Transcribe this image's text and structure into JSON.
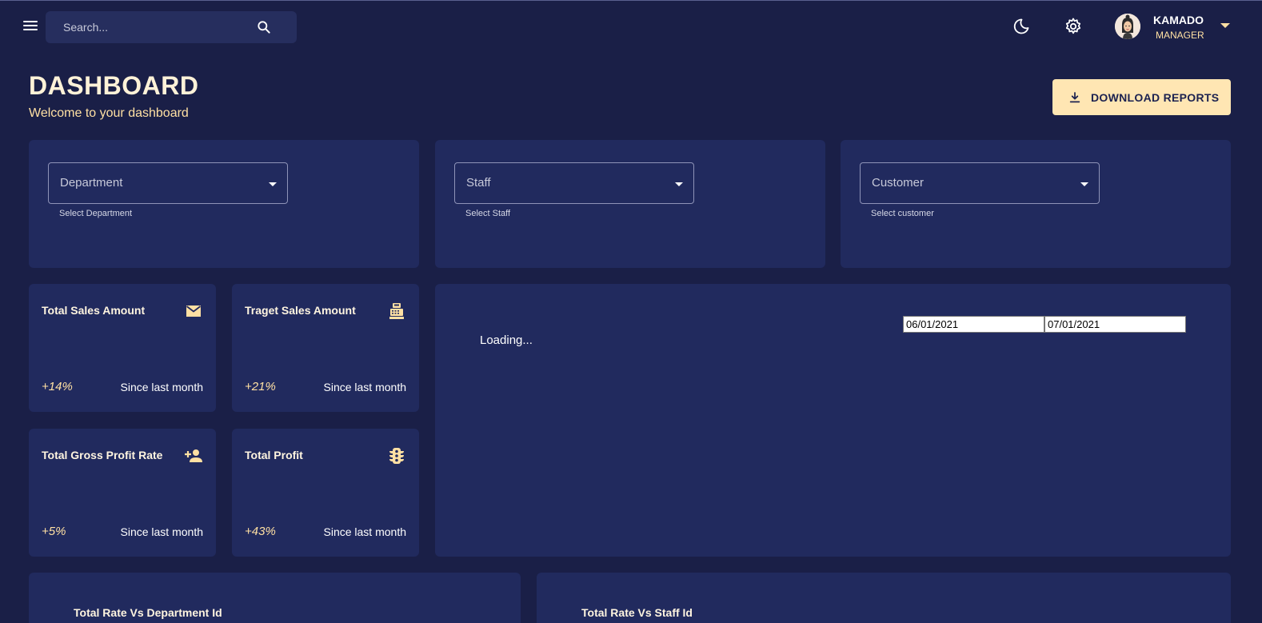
{
  "topbar": {
    "search_placeholder": "Search...",
    "user": {
      "name": "KAMADO",
      "role": "MANAGER"
    }
  },
  "header": {
    "title": "DASHBOARD",
    "subtitle": "Welcome to your dashboard",
    "download_label": "DOWNLOAD REPORTS"
  },
  "filters": [
    {
      "label": "Department",
      "helper": "Select Department"
    },
    {
      "label": "Staff",
      "helper": "Select Staff"
    },
    {
      "label": "Customer",
      "helper": "Select customer"
    }
  ],
  "stats": [
    {
      "title": "Total Sales Amount",
      "percent": "+14%",
      "since": "Since last month",
      "icon": "mail-icon"
    },
    {
      "title": "Traget Sales Amount",
      "percent": "+21%",
      "since": "Since last month",
      "icon": "point-of-sale-icon"
    },
    {
      "title": "Total Gross Profit Rate",
      "percent": "+5%",
      "since": "Since last month",
      "icon": "person-add-icon"
    },
    {
      "title": "Total Profit",
      "percent": "+43%",
      "since": "Since last month",
      "icon": "traffic-icon"
    }
  ],
  "chart_panel": {
    "loading_text": "Loading...",
    "start_date": "06/01/2021",
    "end_date": "07/01/2021"
  },
  "bottom_panels": [
    {
      "title": "Total Rate Vs Department Id"
    },
    {
      "title": "Total Rate Vs Staff Id"
    }
  ],
  "colors": {
    "background": "#1a1f47",
    "card": "#212a5e",
    "accent": "#ffe0a3",
    "button_bg": "#ffe6b3"
  }
}
